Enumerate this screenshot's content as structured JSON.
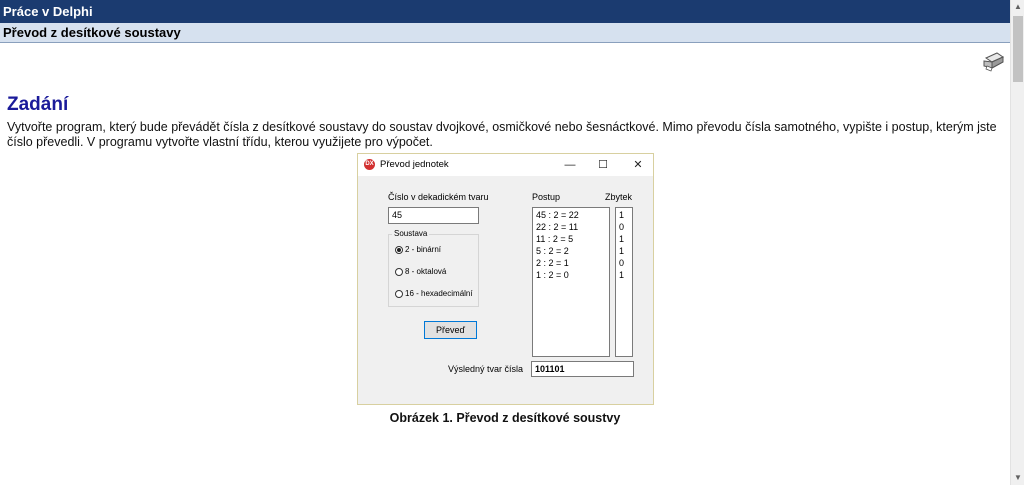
{
  "header": {
    "title": "Práce v Delphi",
    "subtitle": "Převod z desítkové soustavy"
  },
  "section": {
    "heading": "Zadání",
    "paragraph": "Vytvořte program, který bude převádět čísla z desítkové soustavy do soustav dvojkové, osmičkové nebo šesnáctkové. Mimo převodu čísla samotného, vypište i postup, kterým jste číslo převedli. V programu vytvořte vlastní třídu, kterou využijete pro výpočet."
  },
  "icons": {
    "print": "printer-icon",
    "app": "delphi-app-icon"
  },
  "colors": {
    "header_bg": "#1b3b70",
    "subheader_bg": "#d6e1ef",
    "heading": "#1a1a9a"
  },
  "app_window": {
    "title": "Převod jednotek",
    "icon_text": "DX",
    "controls": {
      "minimize": "—",
      "maximize": "☐",
      "close": "✕"
    },
    "decimal_label": "Číslo v dekadickém tvaru",
    "decimal_value": "45",
    "group_label": "Soustava",
    "options": [
      "2 - binární",
      "8 - oktalová",
      "16 - hexadecimální"
    ],
    "selected_option": 0,
    "convert_button": "Převeď",
    "procedure_label": "Postup",
    "remainder_label": "Zbytek",
    "procedure": [
      "45 : 2 = 22",
      "22 : 2 = 11",
      "11 : 2 = 5",
      "5 : 2 = 2",
      "2 : 2 = 1",
      "1 : 2 = 0"
    ],
    "remainders": [
      "1",
      "0",
      "1",
      "1",
      "0",
      "1"
    ],
    "result_label": "Výsledný tvar čísla",
    "result_value": "101101"
  },
  "caption": "Obrázek 1. Převod z desítkové soustvy"
}
